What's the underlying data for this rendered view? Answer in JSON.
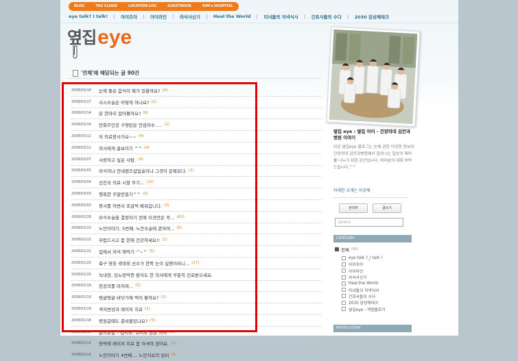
{
  "top_tabs": [
    "BLOG",
    "TAG CLOUD",
    "LOCATION LOG",
    "GUESTBOOK",
    "KIM's HOSPITAL"
  ],
  "nav": [
    "eye talk? I talk!",
    "아이조아",
    "아이라인",
    "라식사신기",
    "Heal the World",
    "미녀들의 저녁식사",
    "간호사들의 수다",
    "2030 감성채테크"
  ],
  "logo": {
    "ko": "옆집",
    "en": "eye"
  },
  "list_header": "'전체'에 해당되는 글 90건",
  "posts": [
    {
      "date": "2008/03/18",
      "title": "눈에 좋은 음식이 뭐가 있을까요?",
      "count": "(4)"
    },
    {
      "date": "2008/03/17",
      "title": "사시수술은 어떻게 하나요?",
      "count": "(2)"
    },
    {
      "date": "2008/03/14",
      "title": "닭 한마리 잡아볼까요?",
      "count": "(6)"
    },
    {
      "date": "2008/03/14",
      "title": "만화주인공 구영탄은 안검하수.....",
      "count": "(1)"
    },
    {
      "date": "2008/03/12",
      "title": "저 의료봉사가요~~",
      "count": "(4)"
    },
    {
      "date": "2008/03/11",
      "title": "의사에게 꼴보이기 ^^",
      "count": "(4)"
    },
    {
      "date": "2008/03/07",
      "title": "사랑하고 싶은 사람.",
      "count": "(4)"
    },
    {
      "date": "2008/03/05",
      "title": "라식이나 안내렌즈삽입술이나 그것이 문제로다.",
      "count": "(1)"
    },
    {
      "date": "2008/03/04",
      "title": "선진국 의료 시찰 후기...",
      "count": "(12)"
    },
    {
      "date": "2008/03/03",
      "title": "행복한 주말만들기^^",
      "count": "(3)"
    },
    {
      "date": "2008/03/03",
      "title": "봉사를 하면서 조금씩 배워갑니다.",
      "count": "(3)"
    },
    {
      "date": "2008/02/28",
      "title": "라식수술을 결정하기 전에 이것만은 꼭…",
      "count": "(62)"
    },
    {
      "date": "2008/02/22",
      "title": "노안이야기, 5번째. 노안수술에 관하여...",
      "count": "(6)"
    },
    {
      "date": "2008/02/22",
      "title": "부럽드시고 좀 한해 건강하세요!!",
      "count": "(1)"
    },
    {
      "date": "2008/02/21",
      "title": "집에서 저녁 해먹기 ^~^",
      "count": "(5)"
    },
    {
      "date": "2008/02/20",
      "title": "축구 영웅 곽태휘 선수가 한쪽 눈이 실명이라니...",
      "count": "(27)"
    },
    {
      "date": "2008/02/20",
      "title": "녹내장, 당뇨망막증 환자도 한 의사에게 꾸준히 진료받으세요.",
      "count": ""
    },
    {
      "date": "2008/02/19",
      "title": "전공의를 마치며...",
      "count": "(5)"
    },
    {
      "date": "2008/02/19",
      "title": "탱글탱글 바닷가재 먹어 볼까요?",
      "count": "(3)"
    },
    {
      "date": "2008/02/19",
      "title": "격자변성과 레이저 치료",
      "count": "(1)"
    },
    {
      "date": "2008/02/18",
      "title": "병원갈때도 준비물있나요?",
      "count": "(5)"
    },
    {
      "date": "2008/02/15",
      "title": "춘지유감 – 검지도, 뉘지도 않은 의사",
      "count": "(6)"
    },
    {
      "date": "2008/02/15",
      "title": "망막에 레이저 치료 좀 하셔야 겠어요.",
      "count": "(2)"
    },
    {
      "date": "2008/02/14",
      "title": "노안이야기 4번째.... 노안치료의 원리",
      "count": "(8)"
    }
  ],
  "profile": {
    "title": "옆집 eye : 옆집 아이 - 건양의대 김안과 병원 이야기",
    "desc": "이곳 옆집eye 블로그는 눈에 관한 다양한 정보와 건양의대 김안과병원에서 일어나는 일상의 재미를 나누기 위한 공간입니다. 여러분의 대화 부탁드립니다.^^",
    "link": "자세한 소개는 이곳에"
  },
  "buttons": {
    "admin": "관리자",
    "write": "글쓰기"
  },
  "search": {
    "placeholder": "SEARCH"
  },
  "category": {
    "header": "CATEGORY",
    "root": "전체",
    "root_count": "(90)",
    "items": [
      "eye talk ?_I talk !",
      "아이조아",
      "아이라인",
      "라식사신기",
      "Heal the World",
      "미녀들의 저녁식사",
      "간호사들의 수다",
      "2030 감성재테크",
      "옆집eye : 객원블로거"
    ]
  },
  "photo_story": "PHOTO STORY"
}
